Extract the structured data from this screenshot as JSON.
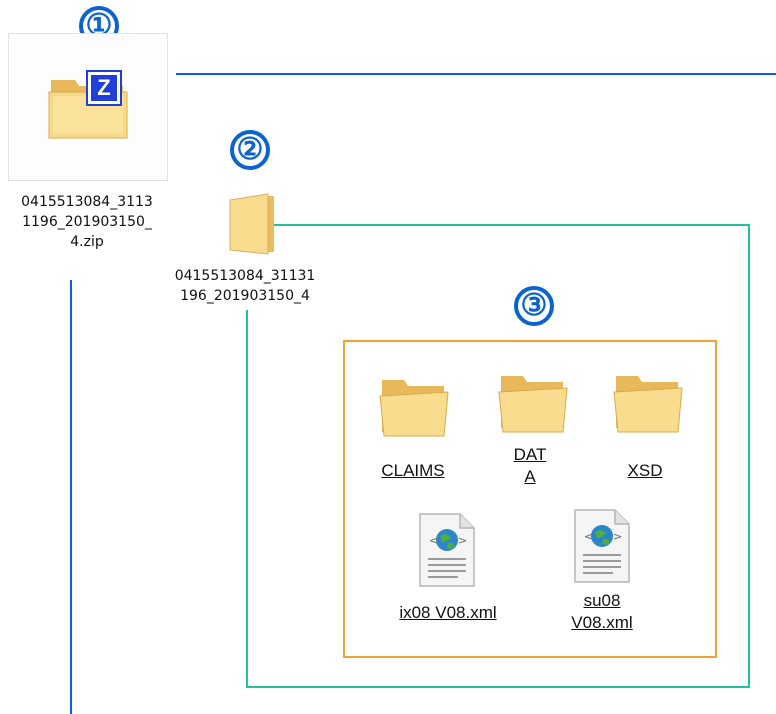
{
  "colors": {
    "blue": "#0a63cf",
    "green": "#25c29a",
    "orange": "#f2a234",
    "folder": "#f5d37a"
  },
  "markers": [
    "①",
    "②",
    "③"
  ],
  "zip_file": {
    "icon": "zip-folder-icon",
    "badge": "Z",
    "name": "0415513084_3113\n1196_201903150_\n4.zip"
  },
  "extracted_folder": {
    "icon": "folder-icon",
    "name": "0415513084_31131\n196_201903150_4"
  },
  "contents": {
    "folders": [
      {
        "name": "CLAIMS",
        "icon": "folder-icon"
      },
      {
        "name": "DAT\nA",
        "icon": "folder-icon"
      },
      {
        "name": "XSD",
        "icon": "folder-icon"
      }
    ],
    "files": [
      {
        "name": "ix08 V08.xml",
        "icon": "xml-file-icon"
      },
      {
        "name": "su08\nV08.xml",
        "icon": "xml-file-icon"
      }
    ]
  }
}
